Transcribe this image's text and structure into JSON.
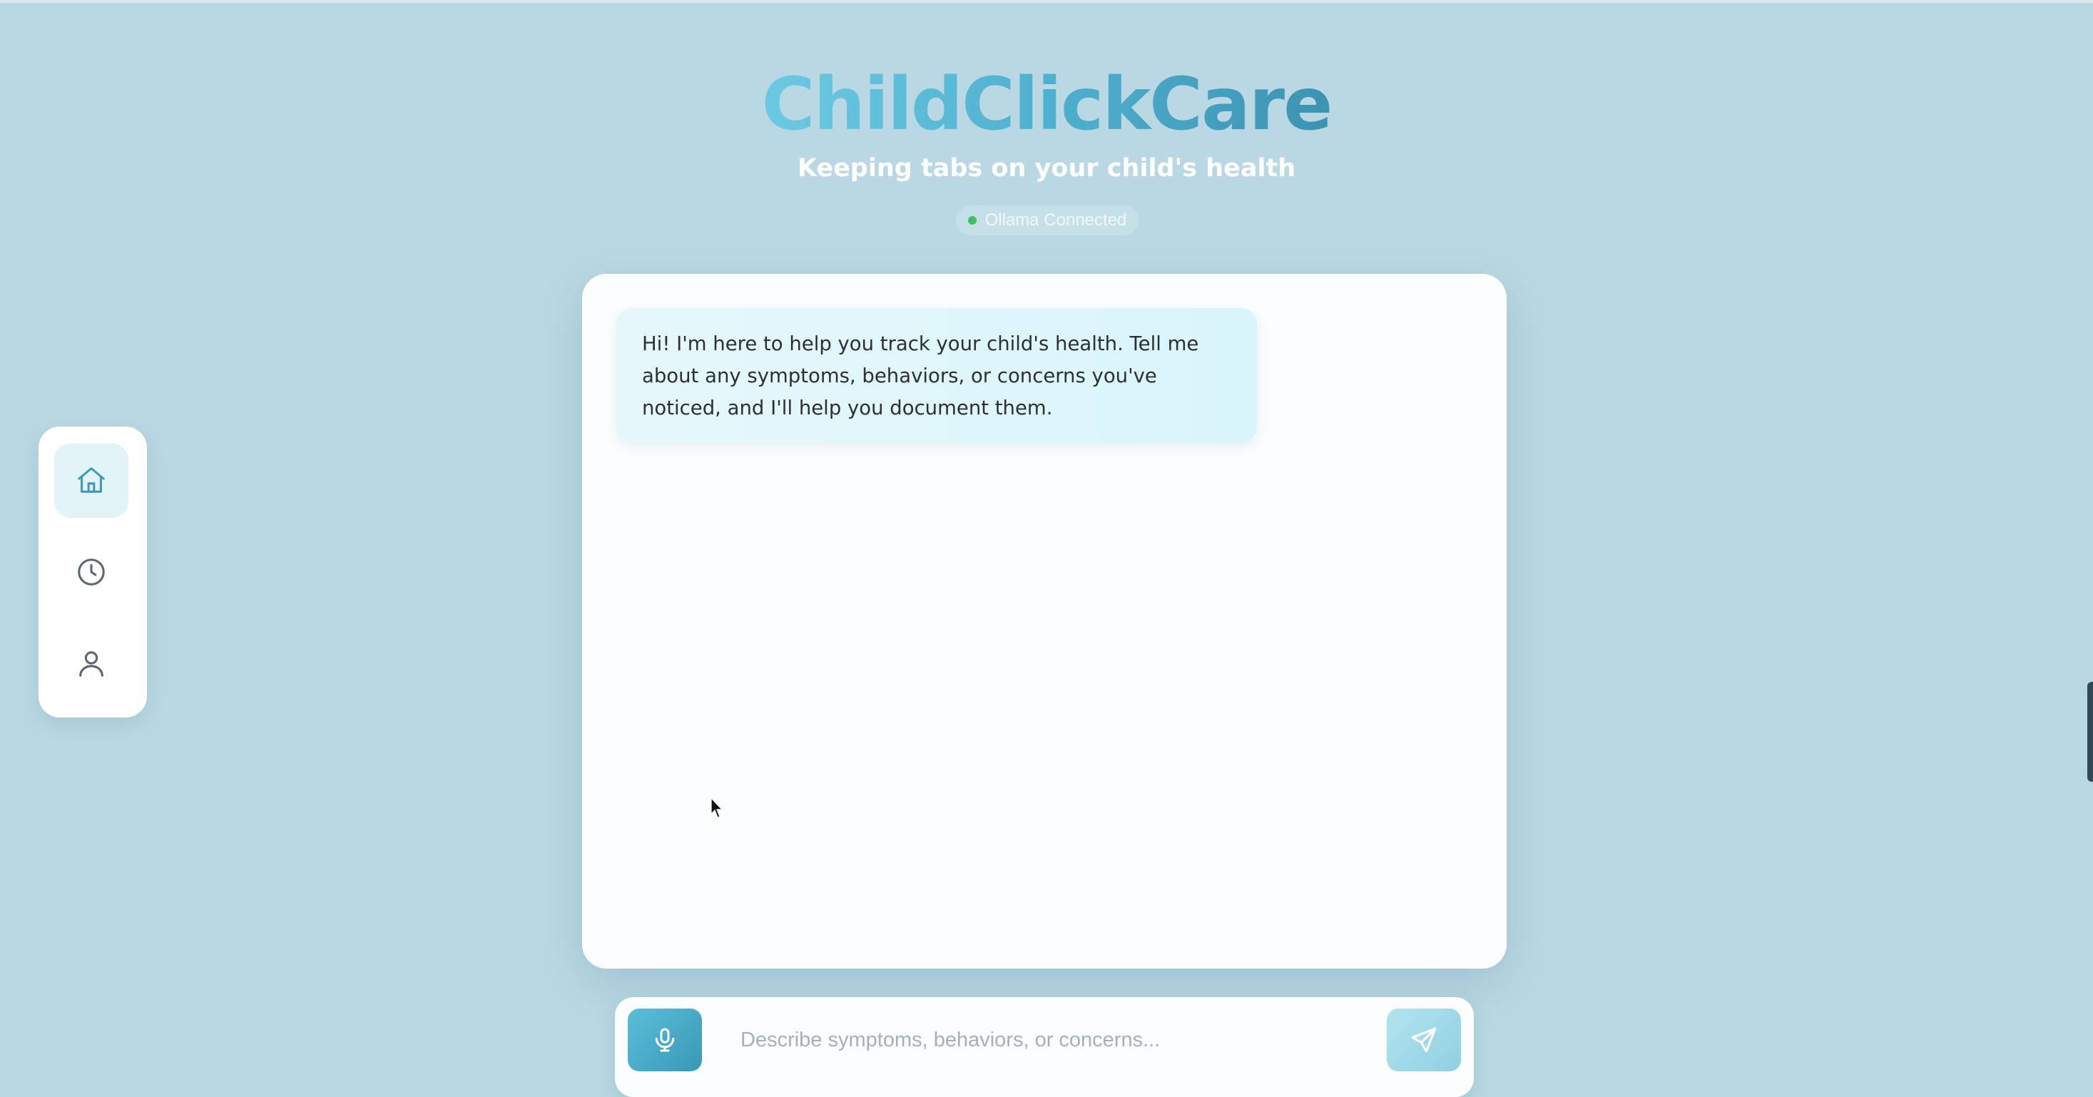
{
  "header": {
    "app_title": "ChildClickCare",
    "tagline": "Keeping tabs on your child's health",
    "status": {
      "text": "Ollama Connected",
      "state": "connected",
      "color": "#3fbf62"
    }
  },
  "sidebar": {
    "items": [
      {
        "icon": "home-icon",
        "active": true
      },
      {
        "icon": "clock-icon",
        "active": false
      },
      {
        "icon": "user-icon",
        "active": false
      }
    ]
  },
  "chat": {
    "messages": [
      {
        "role": "assistant",
        "text": "Hi! I'm here to help you track your child's health. Tell me about any symptoms, behaviors, or concerns you've noticed, and I'll help you document them."
      }
    ]
  },
  "composer": {
    "placeholder": "Describe symptoms, behaviors, or concerns...",
    "value": "",
    "mic_icon": "microphone-icon",
    "send_icon": "send-icon"
  },
  "colors": {
    "background": "#b9d8e3",
    "accent": "#4fb1cf",
    "accent_dark": "#3998b8",
    "bubble": "#dcf5fb"
  }
}
